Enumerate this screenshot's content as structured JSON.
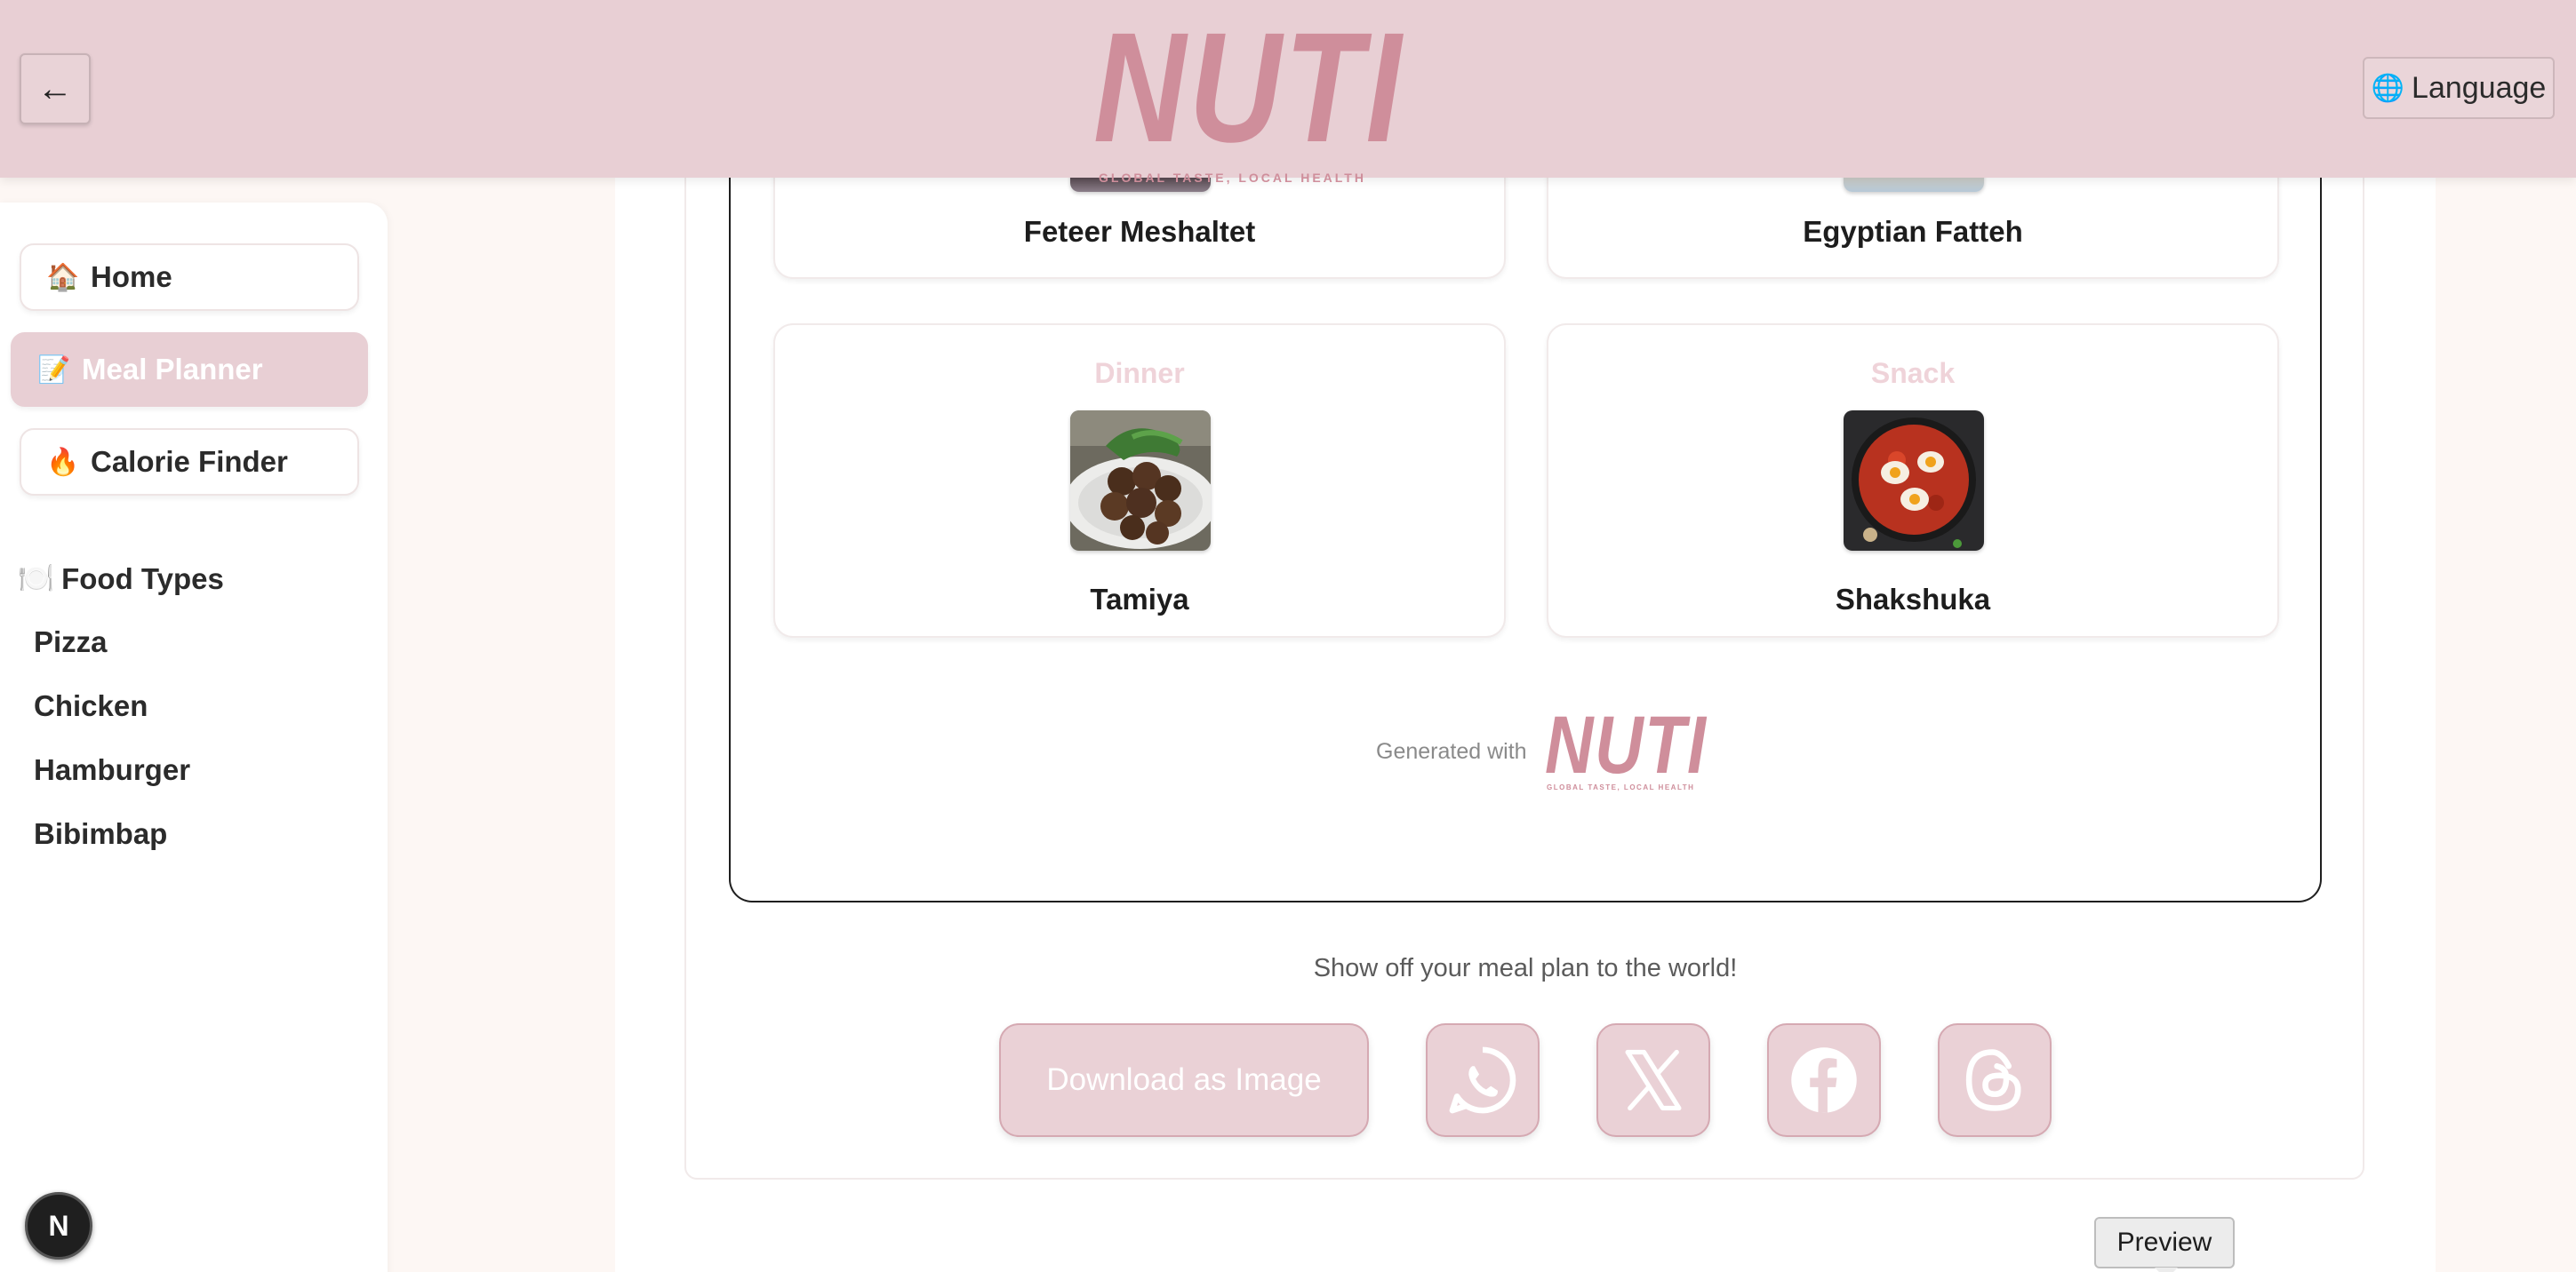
{
  "header": {
    "back_symbol": "←",
    "brand_name": "NUTI",
    "brand_tagline": "GLOBAL TASTE, LOCAL HEALTH",
    "language_label": "Language",
    "language_icon": "globe-icon"
  },
  "sidebar": {
    "nav": [
      {
        "label": "Home",
        "icon": "🏠",
        "icon_name": "house-icon"
      },
      {
        "label": "Meal Planner",
        "icon": "📝",
        "icon_name": "memo-icon",
        "active": true
      },
      {
        "label": "Calorie Finder",
        "icon": "🔥",
        "icon_name": "fire-icon"
      }
    ],
    "food_types_title": "Food Types",
    "food_types_icon": "🍽️",
    "food_types": [
      "Pizza",
      "Chicken",
      "Hamburger",
      "Bibimbap"
    ]
  },
  "meal_plan": {
    "top_cards": [
      {
        "name": "Feteer Meshaltet"
      },
      {
        "name": "Egyptian Fatteh"
      }
    ],
    "cards": [
      {
        "type": "Dinner",
        "name": "Tamiya",
        "image": "falafel-plate-image"
      },
      {
        "type": "Snack",
        "name": "Shakshuka",
        "image": "shakshuka-pan-image"
      }
    ],
    "generated_with": "Generated with",
    "footer_brand": "NUTI",
    "footer_tagline": "GLOBAL TASTE, LOCAL HEALTH"
  },
  "share": {
    "prompt": "Show off your meal plan to the world!",
    "download_label": "Download as Image",
    "networks": [
      "whatsapp-icon",
      "x-icon",
      "facebook-icon",
      "threads-icon"
    ]
  },
  "dev": {
    "badge_letter": "N",
    "preview_label": "Preview"
  },
  "colors": {
    "header_bg": "#e8cfd4",
    "brand": "#cf8e9b",
    "accent_soft": "#ead1d6",
    "page_bg": "#fdf7f4"
  }
}
